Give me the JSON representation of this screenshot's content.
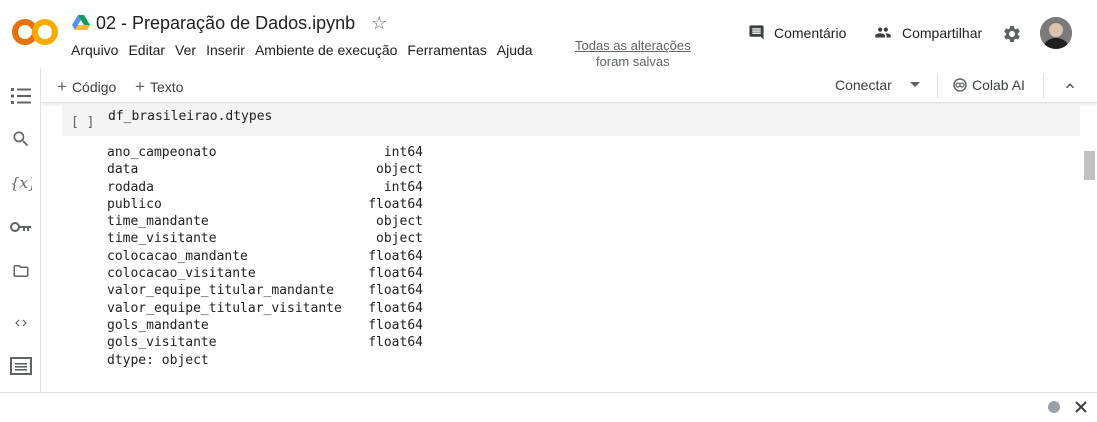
{
  "app": {
    "notebook_title": "02 - Preparação de Dados.ipynb",
    "save_status_line1": "Todas as alterações",
    "save_status_line2": "foram salvas"
  },
  "menu": [
    "Arquivo",
    "Editar",
    "Ver",
    "Inserir",
    "Ambiente de execução",
    "Ferramentas",
    "Ajuda"
  ],
  "header": {
    "comment_label": "Comentário",
    "share_label": "Compartilhar"
  },
  "toolbar": {
    "add_code": "Código",
    "add_text": "Texto",
    "connect": "Conectar",
    "colab_ai": "Colab AI"
  },
  "cell": {
    "run_indicator": "[ ]",
    "code": "df_brasileirao.dtypes",
    "output_rows": [
      {
        "column": "ano_campeonato",
        "dtype": "int64"
      },
      {
        "column": "data",
        "dtype": "object"
      },
      {
        "column": "rodada",
        "dtype": "int64"
      },
      {
        "column": "publico",
        "dtype": "float64"
      },
      {
        "column": "time_mandante",
        "dtype": "object"
      },
      {
        "column": "time_visitante",
        "dtype": "object"
      },
      {
        "column": "colocacao_mandante",
        "dtype": "float64"
      },
      {
        "column": "colocacao_visitante",
        "dtype": "float64"
      },
      {
        "column": "valor_equipe_titular_mandante",
        "dtype": "float64"
      },
      {
        "column": "valor_equipe_titular_visitante",
        "dtype": "float64"
      },
      {
        "column": "gols_mandante",
        "dtype": "float64"
      },
      {
        "column": "gols_visitante",
        "dtype": "float64"
      }
    ],
    "output_footer": "dtype: object"
  },
  "colors": {
    "logo_orange": "#f9ab00",
    "logo_dark_orange": "#e8710a",
    "icon_gray": "#5f6368"
  }
}
